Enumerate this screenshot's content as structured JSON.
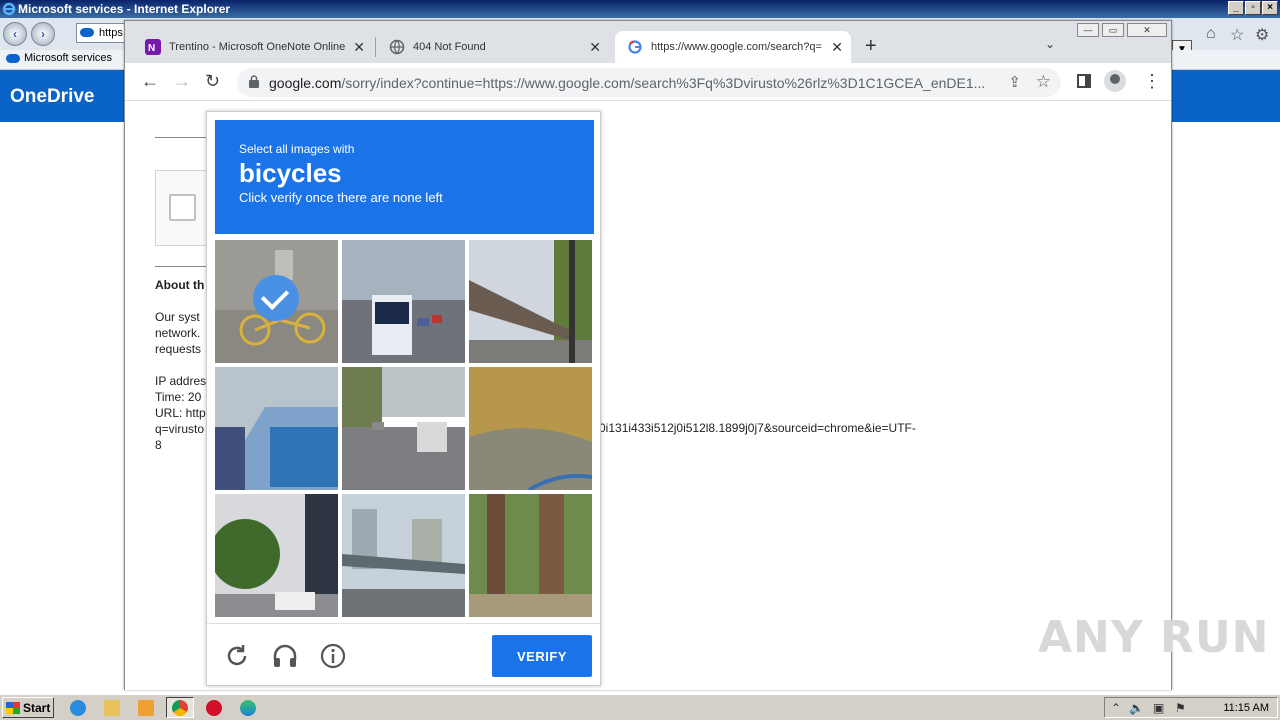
{
  "ie": {
    "title": "Microsoft services - Internet Explorer",
    "address_text": "https",
    "favorites_item": "Microsoft services",
    "onedrive_label": "OneDrive"
  },
  "chrome": {
    "tabs": [
      {
        "label": "Trentino - Microsoft OneNote Online",
        "favicon": "onenote-icon"
      },
      {
        "label": "404 Not Found",
        "favicon": "globe-icon"
      },
      {
        "label": "https://www.google.com/search?q=",
        "favicon": "google-icon",
        "active": true
      }
    ],
    "url_host": "google.com",
    "url_rest": "/sorry/index?continue=https://www.google.com/search%3Fq%3Dvirusto%26rlz%3D1C1GCEA_enDE1..."
  },
  "page": {
    "about_heading": "About th",
    "body_lines": "Our syst\nnetwork.\nrequests",
    "info_lines": "IP addres\nTime: 20\nURL: http\nq=virusto\n8",
    "url_tail": "0i131i433i512j0i512l8.1899j0j7&sourceid=chrome&ie=UTF-"
  },
  "captcha": {
    "instruction_small": "Select all images with",
    "target_word": "bicycles",
    "instruction_sub": "Click verify once there are none left",
    "verify_label": "VERIFY",
    "selected_tiles": [
      0
    ]
  },
  "watermark": "ANY RUN",
  "taskbar": {
    "start_label": "Start",
    "clock": "11:15 AM"
  },
  "colors": {
    "captcha_blue": "#1a73e8",
    "onedrive_blue": "#0a64c8",
    "check_blue": "#4a90e2"
  }
}
